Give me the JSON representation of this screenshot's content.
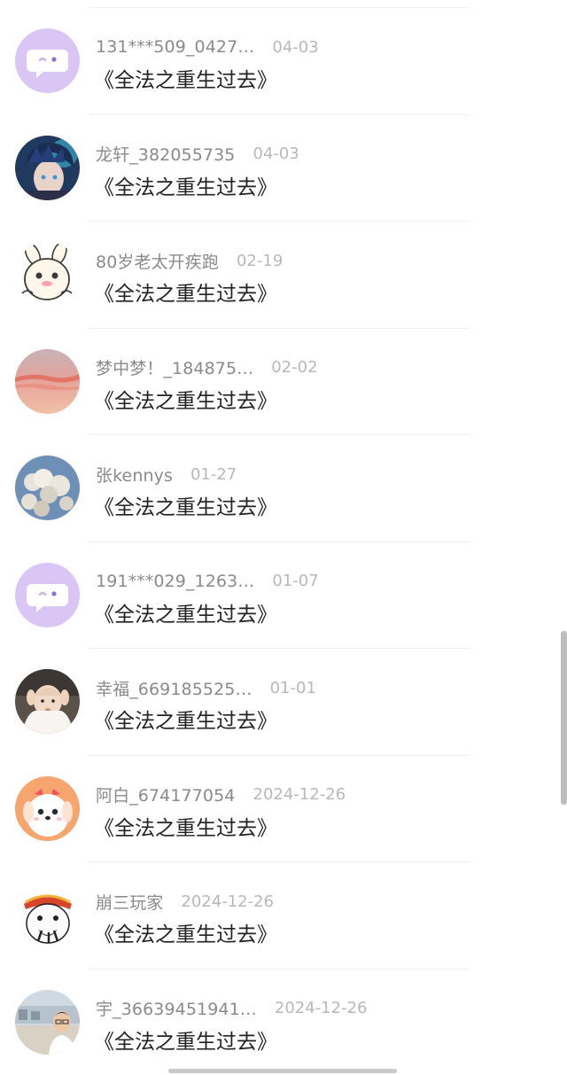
{
  "comments": [
    {
      "username": "131***509_0427…",
      "date": "04-03",
      "content": "《全法之重生过去》",
      "avatar": "default-chat-avatar"
    },
    {
      "username": "龙轩_382055735",
      "date": "04-03",
      "content": "《全法之重生过去》",
      "avatar": "anime-boy-avatar"
    },
    {
      "username": "80岁老太开疾跑",
      "date": "02-19",
      "content": "《全法之重生过去》",
      "avatar": "cartoon-bunny-avatar"
    },
    {
      "username": "梦中梦！_184875…",
      "date": "02-02",
      "content": "《全法之重生过去》",
      "avatar": "sunset-sky-avatar"
    },
    {
      "username": "张kennys",
      "date": "01-27",
      "content": "《全法之重生过去》",
      "avatar": "clouds-avatar"
    },
    {
      "username": "191***029_1263…",
      "date": "01-07",
      "content": "《全法之重生过去》",
      "avatar": "default-chat-avatar"
    },
    {
      "username": "幸福_669185525…",
      "date": "01-01",
      "content": "《全法之重生过去》",
      "avatar": "baby-photo-avatar"
    },
    {
      "username": "阿白_674177054",
      "date": "2024-12-26",
      "content": "《全法之重生过去》",
      "avatar": "cartoon-puppy-avatar"
    },
    {
      "username": "崩三玩家",
      "date": "2024-12-26",
      "content": "《全法之重生过去》",
      "avatar": "meme-avatar"
    },
    {
      "username": "宇_36639451941…",
      "date": "2024-12-26",
      "content": "《全法之重生过去》",
      "avatar": "man-photo-avatar"
    }
  ]
}
